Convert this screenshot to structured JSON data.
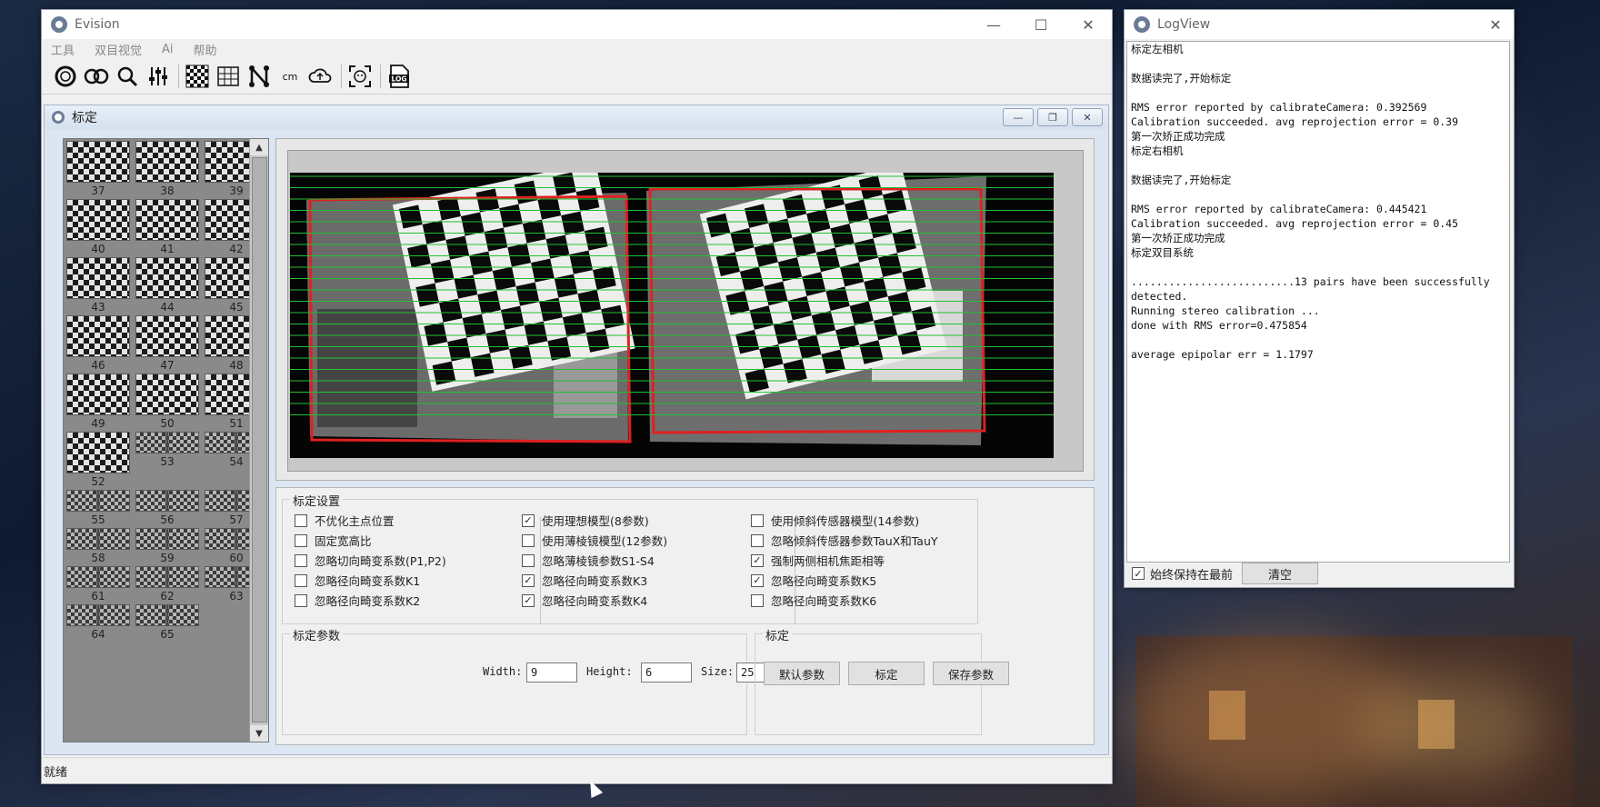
{
  "main_window": {
    "title": "Evision",
    "menu": [
      "工具",
      "双目视觉",
      "Ai",
      "帮助"
    ],
    "toolbar_icons": [
      "circle-icon",
      "double-circle-icon",
      "zoom-icon",
      "sliders-icon",
      "checkerboard-icon",
      "grid-icon",
      "graph-icon",
      "cm-icon",
      "cloud-icon",
      "face-scan-icon",
      "log-icon"
    ],
    "toolbar_cm_label": "cm",
    "toolbar_log_label": "LOG",
    "status": "就绪"
  },
  "calib_window": {
    "title": "标定",
    "thumbnails": [
      "37",
      "38",
      "39",
      "40",
      "41",
      "42",
      "43",
      "44",
      "45",
      "46",
      "47",
      "48",
      "49",
      "50",
      "51",
      "52",
      "53",
      "54",
      "55",
      "56",
      "57",
      "58",
      "59",
      "60",
      "61",
      "62",
      "63",
      "64",
      "65"
    ],
    "settings_group": "标定设置",
    "options": [
      {
        "label": "不优化主点位置",
        "checked": false
      },
      {
        "label": "固定宽高比",
        "checked": false
      },
      {
        "label": "忽略切向畸变系数(P1,P2)",
        "checked": false
      },
      {
        "label": "忽略径向畸变系数K1",
        "checked": false
      },
      {
        "label": "忽略径向畸变系数K2",
        "checked": false
      },
      {
        "label": "使用理想模型(8参数)",
        "checked": true
      },
      {
        "label": "使用薄棱镜模型(12参数)",
        "checked": false
      },
      {
        "label": "忽略薄棱镜参数S1-S4",
        "checked": false
      },
      {
        "label": "忽略径向畸变系数K3",
        "checked": true
      },
      {
        "label": "忽略径向畸变系数K4",
        "checked": true
      },
      {
        "label": "使用倾斜传感器模型(14参数)",
        "checked": false
      },
      {
        "label": "忽略倾斜传感器参数TauX和TauY",
        "checked": false
      },
      {
        "label": "强制两侧相机焦距相等",
        "checked": true
      },
      {
        "label": "忽略径向畸变系数K5",
        "checked": true
      },
      {
        "label": "忽略径向畸变系数K6",
        "checked": false
      }
    ],
    "params_group": "标定参数",
    "width_label": "Width:",
    "width_value": "9",
    "height_label": "Height:",
    "height_value": "6",
    "size_label": "Size:",
    "size_value": "25",
    "action_group": "标定",
    "btn_default": "默认参数",
    "btn_calibrate": "标定",
    "btn_save": "保存参数"
  },
  "log_window": {
    "title": "LogView",
    "lines": [
      "标定左相机",
      "",
      "数据读完了,开始标定",
      "",
      "RMS error reported by calibrateCamera: 0.392569",
      "Calibration succeeded. avg reprojection error = 0.39",
      "第一次矫正成功完成",
      "标定右相机",
      "",
      "数据读完了,开始标定",
      "",
      "RMS error reported by calibrateCamera: 0.445421",
      "Calibration succeeded. avg reprojection error = 0.45",
      "第一次矫正成功完成",
      "标定双目系统",
      "",
      "..........................13 pairs have been successfully",
      "detected.",
      "Running stereo calibration ...",
      "done with RMS error=0.475854",
      "",
      "average epipolar err = 1.1797"
    ],
    "always_on_top_label": "始终保持在最前",
    "always_on_top_checked": true,
    "clear_label": "清空"
  }
}
